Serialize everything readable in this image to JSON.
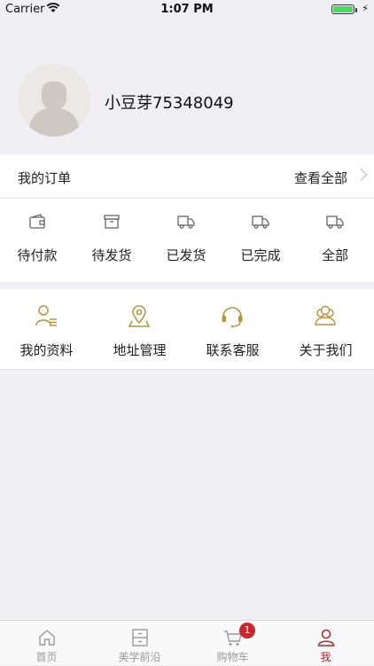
{
  "status": {
    "carrier": "Carrier",
    "time": "1:07 PM"
  },
  "profile": {
    "username": "小豆芽75348049"
  },
  "orders": {
    "title": "我的订单",
    "view_all": "查看全部",
    "items": [
      "待付款",
      "待发货",
      "已发货",
      "已完成",
      "全部"
    ]
  },
  "services": {
    "items": [
      "我的资料",
      "地址管理",
      "联系客服",
      "关于我们"
    ]
  },
  "tabbar": {
    "items": [
      "首页",
      "美学前沿",
      "购物车",
      "我"
    ],
    "cart_badge": "1"
  },
  "colors": {
    "accent": "#b0222c",
    "gold": "#b8923a",
    "icon_gray": "#666666"
  }
}
